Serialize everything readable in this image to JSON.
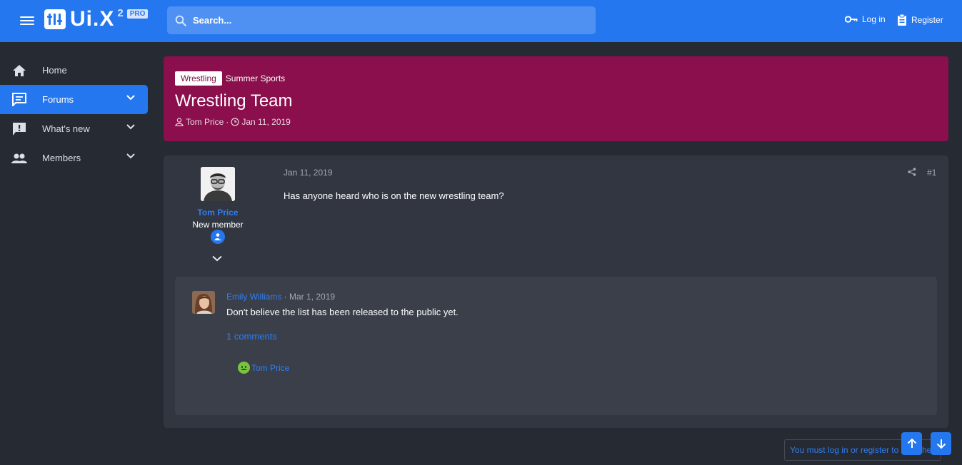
{
  "header": {
    "logo": {
      "text": "Ui.X",
      "superscript": "2",
      "badge": "PRO"
    },
    "search": {
      "placeholder": "Search..."
    },
    "login_label": "Log in",
    "register_label": "Register",
    "accent_color": "#2577ef"
  },
  "sidebar": {
    "items": [
      {
        "label": "Home",
        "icon": "home-icon",
        "active": false,
        "expandable": false
      },
      {
        "label": "Forums",
        "icon": "forum-icon",
        "active": true,
        "expandable": true
      },
      {
        "label": "What's new",
        "icon": "alert-icon",
        "active": false,
        "expandable": true
      },
      {
        "label": "Members",
        "icon": "members-icon",
        "active": false,
        "expandable": true
      }
    ]
  },
  "thread": {
    "prefix_label": "Wrestling",
    "subtitle": "Summer Sports",
    "title": "Wrestling Team",
    "author": "Tom Price",
    "meta_separator": "·",
    "date": "Jan 11, 2019",
    "banner_color": "#8a0f4c"
  },
  "post": {
    "author": "Tom Price",
    "author_title": "New member",
    "date": "Jan 11, 2019",
    "number": "#1",
    "body": "Has anyone heard who is on the new wrestling team?"
  },
  "comment": {
    "author": "Emily Williams",
    "separator": "·",
    "date": "Mar 1, 2019",
    "body": "Don't believe the list has been released to the public yet.",
    "comments_link": "1 comments",
    "reaction_user": "Tom Price",
    "reaction_icon": "frown-emoji-icon"
  },
  "footer": {
    "login_notice": "You must log in or register to reply here."
  }
}
